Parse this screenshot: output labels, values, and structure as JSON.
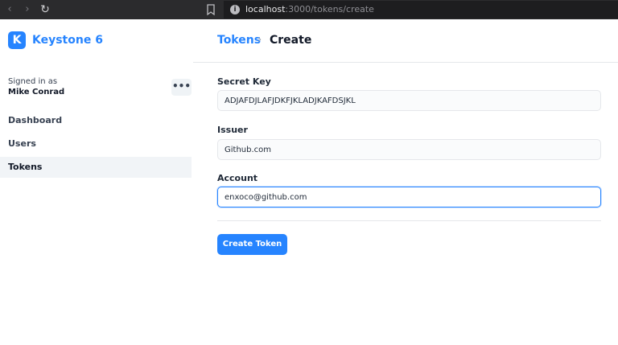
{
  "browser": {
    "url_host": "localhost",
    "url_path": ":3000/tokens/create",
    "icons": {
      "back": "arrow-left-icon",
      "forward": "arrow-right-icon",
      "reload": "reload-icon",
      "bookmark": "bookmark-icon",
      "info": "info-icon"
    }
  },
  "sidebar": {
    "logo_letter": "K",
    "brand_name": "Keystone 6",
    "signed_in_label": "Signed in as",
    "user_name": "Mike Conrad",
    "more_label": "•••",
    "items": [
      {
        "label": "Dashboard",
        "active": false
      },
      {
        "label": "Users",
        "active": false
      },
      {
        "label": "Tokens",
        "active": true
      }
    ]
  },
  "header": {
    "breadcrumb_link": "Tokens",
    "breadcrumb_sep": "›",
    "breadcrumb_current": "Create"
  },
  "form": {
    "fields": [
      {
        "label": "Secret Key",
        "value": "ADJAFDJLAFJDKFJKLADJKAFDSJKL"
      },
      {
        "label": "Issuer",
        "value": "Github.com"
      },
      {
        "label": "Account",
        "value": "enxoco@github.com"
      }
    ],
    "submit_label": "Create Token"
  },
  "colors": {
    "accent": "#2684ff",
    "active_nav_bg": "#f1f4f7"
  }
}
